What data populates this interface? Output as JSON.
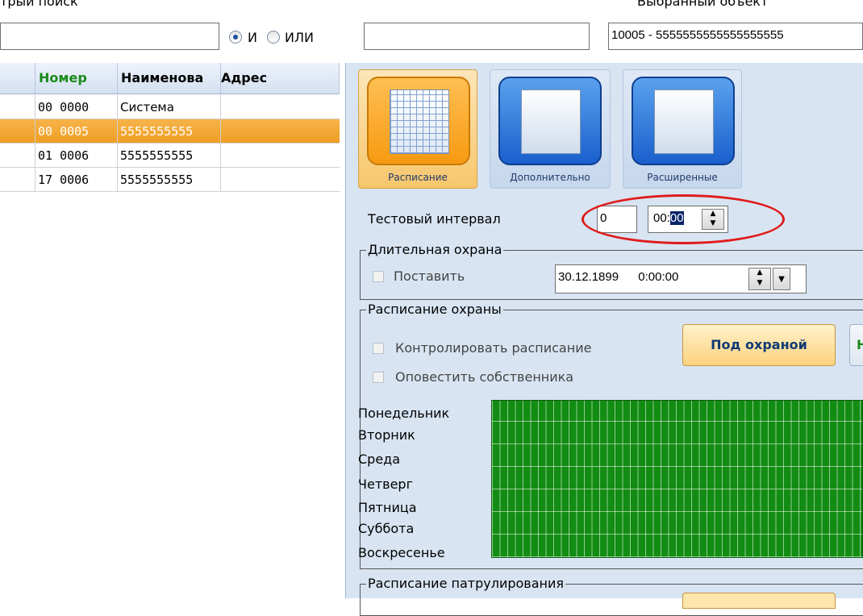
{
  "search": {
    "label_cut": "трыи поиск",
    "query1": "",
    "radio_and": "И",
    "radio_or": "ИЛИ",
    "query2": ""
  },
  "selected_object": {
    "label_cut": "Выбранный объект",
    "value": "10005 - 5555555555555555555"
  },
  "table": {
    "columns": [
      "Номер",
      "Наименова",
      "Адрес"
    ],
    "rows": [
      {
        "num": "00 0000",
        "name": "Система",
        "addr": ""
      },
      {
        "num": "00 0005",
        "name": "5555555555",
        "addr": ""
      },
      {
        "num": "01 0006",
        "name": "5555555555",
        "addr": ""
      },
      {
        "num": "17 0006",
        "name": "5555555555",
        "addr": ""
      }
    ],
    "selected_row_index": 1
  },
  "tabs": [
    {
      "label": "Расписание",
      "icon": "calendar-icon"
    },
    {
      "label": "Дополнительно",
      "icon": "window-icon"
    },
    {
      "label": "Расширенные",
      "icon": "window-icon"
    }
  ],
  "test_interval": {
    "label": "Тестовый интервал",
    "days": "0",
    "time_prefix": "00:",
    "time_selected": "00"
  },
  "long_guard": {
    "title": "Длительная охрана",
    "checkbox_label": "Поставить",
    "date": "30.12.1899",
    "time": "0:00:00"
  },
  "guard_schedule": {
    "title": "Расписание охраны",
    "control_label": "Контролировать расписание",
    "notify_label": "Оповестить собственника",
    "button_guarded": "Под охраной",
    "button_cut": "Н",
    "days": [
      "Понедельник",
      "Вторник",
      "Среда",
      "Четверг",
      "Пятница",
      "Суббота",
      "Воскресенье"
    ]
  },
  "patrol_schedule": {
    "title": "Расписание патрулирования"
  },
  "colors": {
    "grid_green": "#128c12",
    "highlight_red": "#e01b1b",
    "selection_orange": "#f2a42d",
    "header_green_text": "#1a8a1a"
  }
}
